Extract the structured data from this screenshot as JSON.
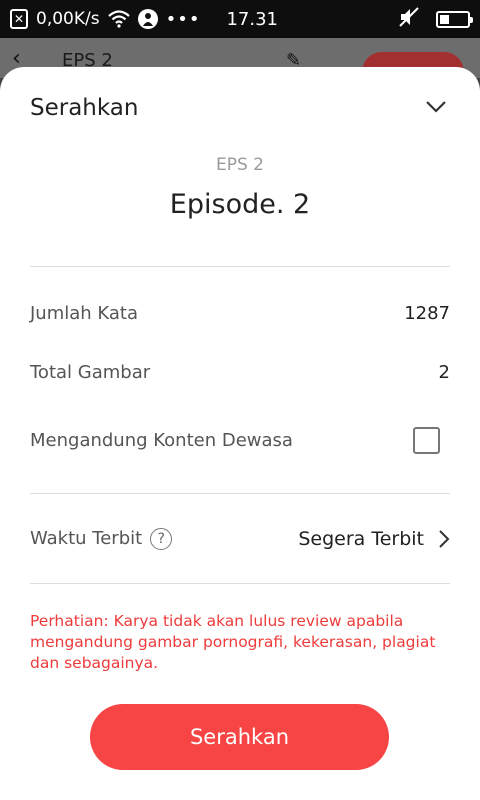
{
  "status_bar": {
    "network_speed": "0,00K/s",
    "more": "•••",
    "time": "17.31",
    "battery_level": 0.35
  },
  "underlay": {
    "back": "‹",
    "title": "EPS 2",
    "edit": "✎"
  },
  "sheet": {
    "title": "Serahkan",
    "episode_label": "EPS 2",
    "episode_title": "Episode. 2",
    "stats": {
      "word_count_label": "Jumlah Kata",
      "word_count_value": "1287",
      "image_count_label": "Total Gambar",
      "image_count_value": "2",
      "adult_content_label": "Mengandung Konten Dewasa",
      "adult_content_checked": false
    },
    "publish": {
      "label": "Waktu Terbit",
      "help": "?",
      "value": "Segera Terbit"
    },
    "notice": "Perhatian: Karya tidak akan lulus review apabila mengandung gambar pornografi, kekerasan, plagiat dan sebagainya.",
    "submit_label": "Serahkan"
  },
  "colors": {
    "accent": "#f74444",
    "notice": "#ee3b3b"
  },
  "icons": [
    "notification-box-icon",
    "wifi-icon",
    "person-icon",
    "mute-icon",
    "battery-icon",
    "chevron-down-icon",
    "help-circle-icon",
    "chevron-right-icon"
  ]
}
